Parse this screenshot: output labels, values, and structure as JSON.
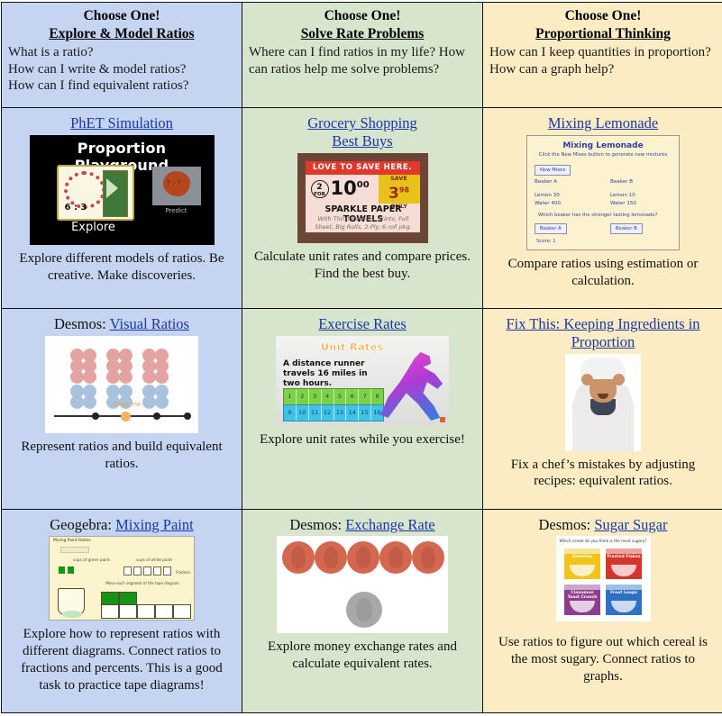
{
  "columns": [
    {
      "id": "explore-model-ratios",
      "color": "#c5d4f0",
      "choose": "Choose One!",
      "heading": "Explore & Model Ratios",
      "questions": "What is a ratio?\nHow can I write & model ratios?\nHow can I find equivalent ratios?"
    },
    {
      "id": "solve-rate-problems",
      "color": "#d7e5cd",
      "choose": "Choose One!",
      "heading": "Solve Rate Problems",
      "questions": "Where can I find ratios in my life?\nHow can ratios help me solve problems?"
    },
    {
      "id": "proportional-thinking",
      "color": "#fcecc3",
      "choose": "Choose One!",
      "heading": "Proportional Thinking",
      "questions": "How can I keep quantities in proportion?\nHow can a graph help?"
    }
  ],
  "cells": {
    "phet": {
      "title_plain": "",
      "title_link": "PhET Simulation",
      "caption": "Explore different models of ratios.  Be creative.  Make discoveries.",
      "thumb": {
        "app_title": "Proportion Playground",
        "explore_label": "Explore",
        "predict_label": "Predict",
        "ratio_label": "6 : 3",
        "splat_label": "? : ?"
      }
    },
    "grocery": {
      "title_plain": "",
      "title_link": "Grocery Shopping\nBest Buys",
      "caption": "Calculate unit rates and compare prices.  Find the best buy.",
      "thumb": {
        "banner": "LOVE TO SAVE HERE.",
        "qty_top": "2",
        "qty_bottom": "FOR",
        "price_dollars": "10",
        "price_cents": "00",
        "save_label": "SAVE",
        "save_dollars": "3",
        "save_cents": "98",
        "save_only": "ONLY",
        "product": "SPARKLE PAPER TOWELS",
        "product_desc": "With Thirst Pockets, Prints, Full Sheet, Big Rolls, 2-Ply, 6 roll pkg."
      }
    },
    "lemonade": {
      "title_plain": "",
      "title_link": "Mixing Lemonade",
      "caption": "Compare ratios using estimation or calculation.",
      "thumb": {
        "title": "Mixing Lemonade",
        "subtitle": "Click the New Mixes button to generate new mixtures",
        "new_mixes_button": "New Mixes",
        "beaker_a_label": "Beaker A",
        "beaker_b_label": "Beaker B",
        "beaker_a_lemon": "Lemon 30",
        "beaker_a_water": "Water 400",
        "beaker_b_lemon": "Lemon 10",
        "beaker_b_water": "Water 150",
        "question": "Which beaker has the stronger tasting lemonade?",
        "answer_a": "Beaker A",
        "answer_b": "Beaker B",
        "score": "Score: 1"
      }
    },
    "visual_ratios": {
      "title_plain": "Desmos:",
      "title_link": "Visual Ratios",
      "caption": "Represent ratios and build equivalent ratios.",
      "thumb": {
        "drag_label": "Drag me"
      }
    },
    "exercise": {
      "title_plain": "",
      "title_link": "Exercise Rates",
      "caption": "Explore unit rates while you exercise!",
      "thumb": {
        "title": "Unit Rates",
        "statement": "A distance runner travels 16 miles in two hours.",
        "strip_top": [
          "1",
          "2",
          "3",
          "4",
          "5",
          "6",
          "7",
          "8"
        ],
        "strip_bottom": [
          "9",
          "10",
          "11",
          "12",
          "13",
          "14",
          "15",
          "16"
        ]
      }
    },
    "fix_this": {
      "title_plain": "",
      "title_link": "Fix This:  Keeping Ingredients in Proportion",
      "caption": "Fix a chef’s mistakes by adjusting recipes:  equivalent ratios."
    },
    "mixing_paint": {
      "title_plain": "Geogebra:",
      "title_link": "Mixing Paint",
      "caption": "Explore how to represent ratios with different diagrams. Connect ratios to fractions and percents. This is a good task to practice tape diagrams!",
      "thumb": {
        "title": "Mixing Paint Ratios",
        "green_label": "cups of green paint",
        "white_label": "cups of white paint",
        "note": "Move each segment of the tape diagram",
        "options": "Fraction"
      }
    },
    "exchange_rate": {
      "title_plain": "Desmos:",
      "title_link": "Exchange Rate",
      "caption": "Explore money exchange rates and calculate equivalent rates."
    },
    "sugar": {
      "title_plain": "Desmos:",
      "title_link": "Sugar Sugar",
      "caption": "Use ratios to figure out which cereal is the most sugary.  Connect ratios to graphs.",
      "thumb": {
        "question": "Which cereal do you think is the most sugary?",
        "cereals": [
          "Cheerios",
          "Frosted Flakes",
          "Cinnamon Toast Crunch",
          "Froot Loops"
        ]
      }
    }
  }
}
